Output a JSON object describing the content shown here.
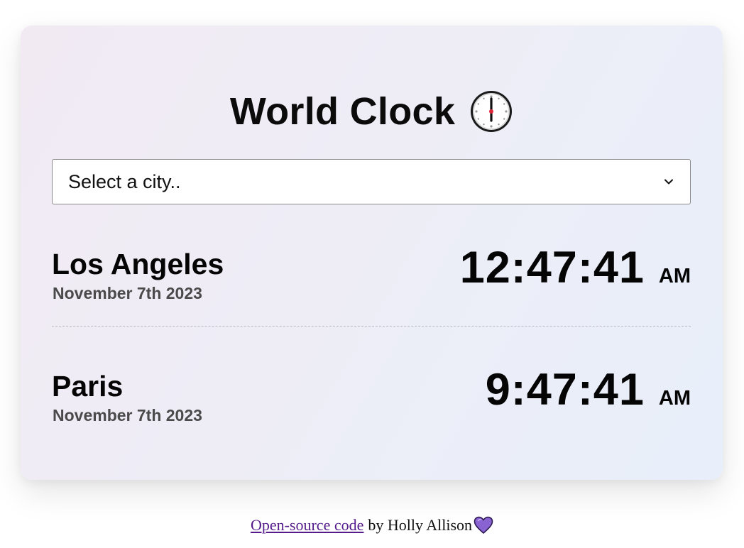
{
  "app": {
    "title": "World Clock",
    "title_icon": "clock-icon"
  },
  "city_select": {
    "selected_label": "Select a city..",
    "icon": "chevron-down-icon"
  },
  "cities": [
    {
      "name": "Los Angeles",
      "date": "November 7th 2023",
      "time": "12:47:41",
      "ampm": "AM"
    },
    {
      "name": "Paris",
      "date": "November 7th 2023",
      "time": "9:47:41",
      "ampm": "AM"
    }
  ],
  "footer": {
    "link_label": "Open-source code",
    "by_text": "by Holly Allison",
    "icon": "purple-heart-icon"
  },
  "colors": {
    "card_gradient_start": "#f1eaf3",
    "card_gradient_end": "#e8effa",
    "link": "#551a8b",
    "heart": "#8a63d2",
    "date_text": "#4a4a4a"
  }
}
